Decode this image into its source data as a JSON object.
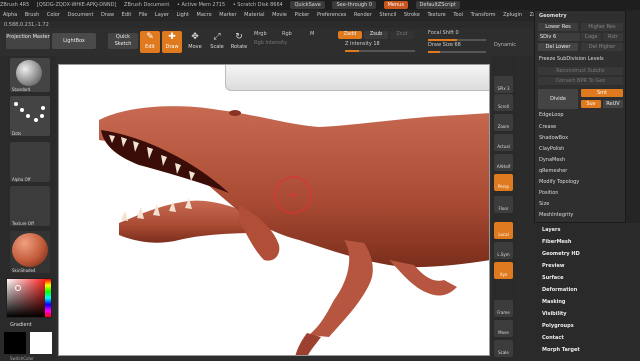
{
  "titlebar": {
    "app": "ZBrush 4R5",
    "doc_id": "[QSDG-ZQDX-WHIE-APKJ-DNND]",
    "doc": "ZBrush Document",
    "active_mem": "• Active Mem 2715",
    "scratch": "• Scratch Disk 8664",
    "quicksave": "QuickSave",
    "see_through": "See-through 0",
    "menus_btn": "Menus",
    "script": "DefaultZScript"
  },
  "menubar": [
    "Alpha",
    "Brush",
    "Color",
    "Document",
    "Draw",
    "Edit",
    "File",
    "Layer",
    "Light",
    "Macro",
    "Marker",
    "Material",
    "Movie",
    "Picker",
    "Preferences",
    "Render",
    "Stencil",
    "Stroke",
    "Texture",
    "Tool",
    "Transform",
    "Zplugin",
    "Zscript"
  ],
  "coords": "0.588,0.231,-1.72",
  "toolbar": {
    "projection_master": "Projection Master",
    "lightbox": "LightBox",
    "quick_sketch": "Quick Sketch",
    "edit": "Edit",
    "draw": "Draw",
    "move": "Move",
    "scale": "Scale",
    "rotate": "Rotate",
    "mrgb": "Mrgb",
    "rgb": "Rgb",
    "m": "M",
    "rgb_intensity": "Rgb Intensity",
    "zadd": "Zadd",
    "zsub": "Zsub",
    "zcut": "Zcut",
    "z_intensity": "Z Intensity 18",
    "focal_shift": "Focal Shift 0",
    "draw_size": "Draw Size 68",
    "dynamic": "Dynamic"
  },
  "left_shelf": {
    "brush_label": "Standard",
    "stroke_label": "Dots",
    "alpha_label": "Alpha Off",
    "texture_label": "Texture Off",
    "material_label": "SkinShade4",
    "gradient_label": "Gradient",
    "switch_color": "SwitchColor"
  },
  "right_shelf": [
    "SPix 3",
    "Scroll",
    "Zoom",
    "Actual",
    "AAHalf",
    "Persp",
    "Floor",
    "Local",
    "L.Sym",
    "Xyz",
    "Frame",
    "Move",
    "Scale"
  ],
  "geometry_panel": {
    "title": "Geometry",
    "lower_res": "Lower Res",
    "higher_res": "Higher Res",
    "sdiv": "SDiv 6",
    "cage": "Cage",
    "rstr": "Rstr",
    "del_lower": "Del Lower",
    "del_higher": "Del Higher",
    "freeze": "Freeze SubDivision Levels",
    "reconstruct": "Reconstruct Subdiv",
    "convert": "Convert BPR To Geo",
    "divide": "Divide",
    "smt": "Smt",
    "suv": "Suv",
    "reuv": "ReUV",
    "items": [
      "EdgeLoop",
      "Crease",
      "ShadowBox",
      "ClayPolish",
      "DynaMesh",
      "qRemesher",
      "Modify Topology",
      "Position",
      "Size",
      "MeshIntegrity"
    ]
  },
  "menus": [
    "Layers",
    "FiberMesh",
    "Geometry HD",
    "Preview",
    "Surface",
    "Deformation",
    "Masking",
    "Visibility",
    "Polygroups",
    "Contact",
    "Morph Target"
  ]
}
